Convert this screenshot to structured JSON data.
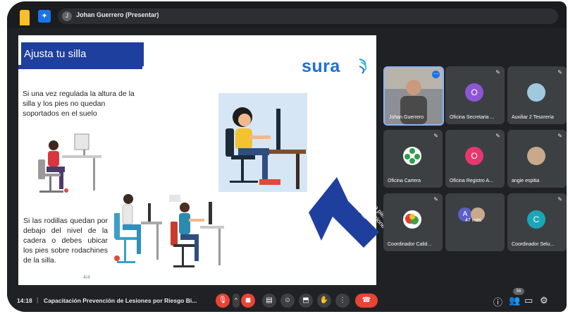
{
  "topbar": {
    "presenter": "Johan Guerrero (Presentar)"
  },
  "slide": {
    "title": "Ajusta tu silla",
    "logo": "sura",
    "paragraph1": "Si una vez regulada la altura de la silla y los pies no quedan soportados en el suelo",
    "paragraph2": "Si las rodillas quedan por debajo del nivel de la cadera o debes ubicar los pies sobre rodachines de la silla.",
    "arrow_text": "Ubica un apoya pies o elemento que funcione como tal",
    "counter": "4/4"
  },
  "participants": [
    {
      "name": "Johan Guerrero",
      "initial": "",
      "color": "",
      "speaking": true
    },
    {
      "name": "Oficina Secretaria ...",
      "initial": "O",
      "color": "#8e56d6"
    },
    {
      "name": "Auxiliar 2 Tesorería",
      "initial": "",
      "color": "#a0c9e0"
    },
    {
      "name": "Oficina Cartera",
      "initial": "",
      "color": "#ffffff"
    },
    {
      "name": "Oficina Registro A...",
      "initial": "O",
      "color": "#e8366e"
    },
    {
      "name": "angie espitia",
      "initial": "",
      "color": "#c9a98c"
    },
    {
      "name": "Coordinador Calid...",
      "initial": "",
      "color": "#ffffff"
    },
    {
      "name": "47 más",
      "initial": "A",
      "color": "#5b5fc7"
    },
    {
      "name": "Coordinador Selu...",
      "initial": "C",
      "color": "#1aa6b7"
    }
  ],
  "bottombar": {
    "time": "14:18",
    "title": "Capacitación Prevención de Lesiones por Riesgo Bi...",
    "participant_count": "56"
  },
  "colors": {
    "slide_blue": "#1f3f9e",
    "end_call_red": "#ea4335",
    "brand_blue": "#1f6fd9"
  }
}
